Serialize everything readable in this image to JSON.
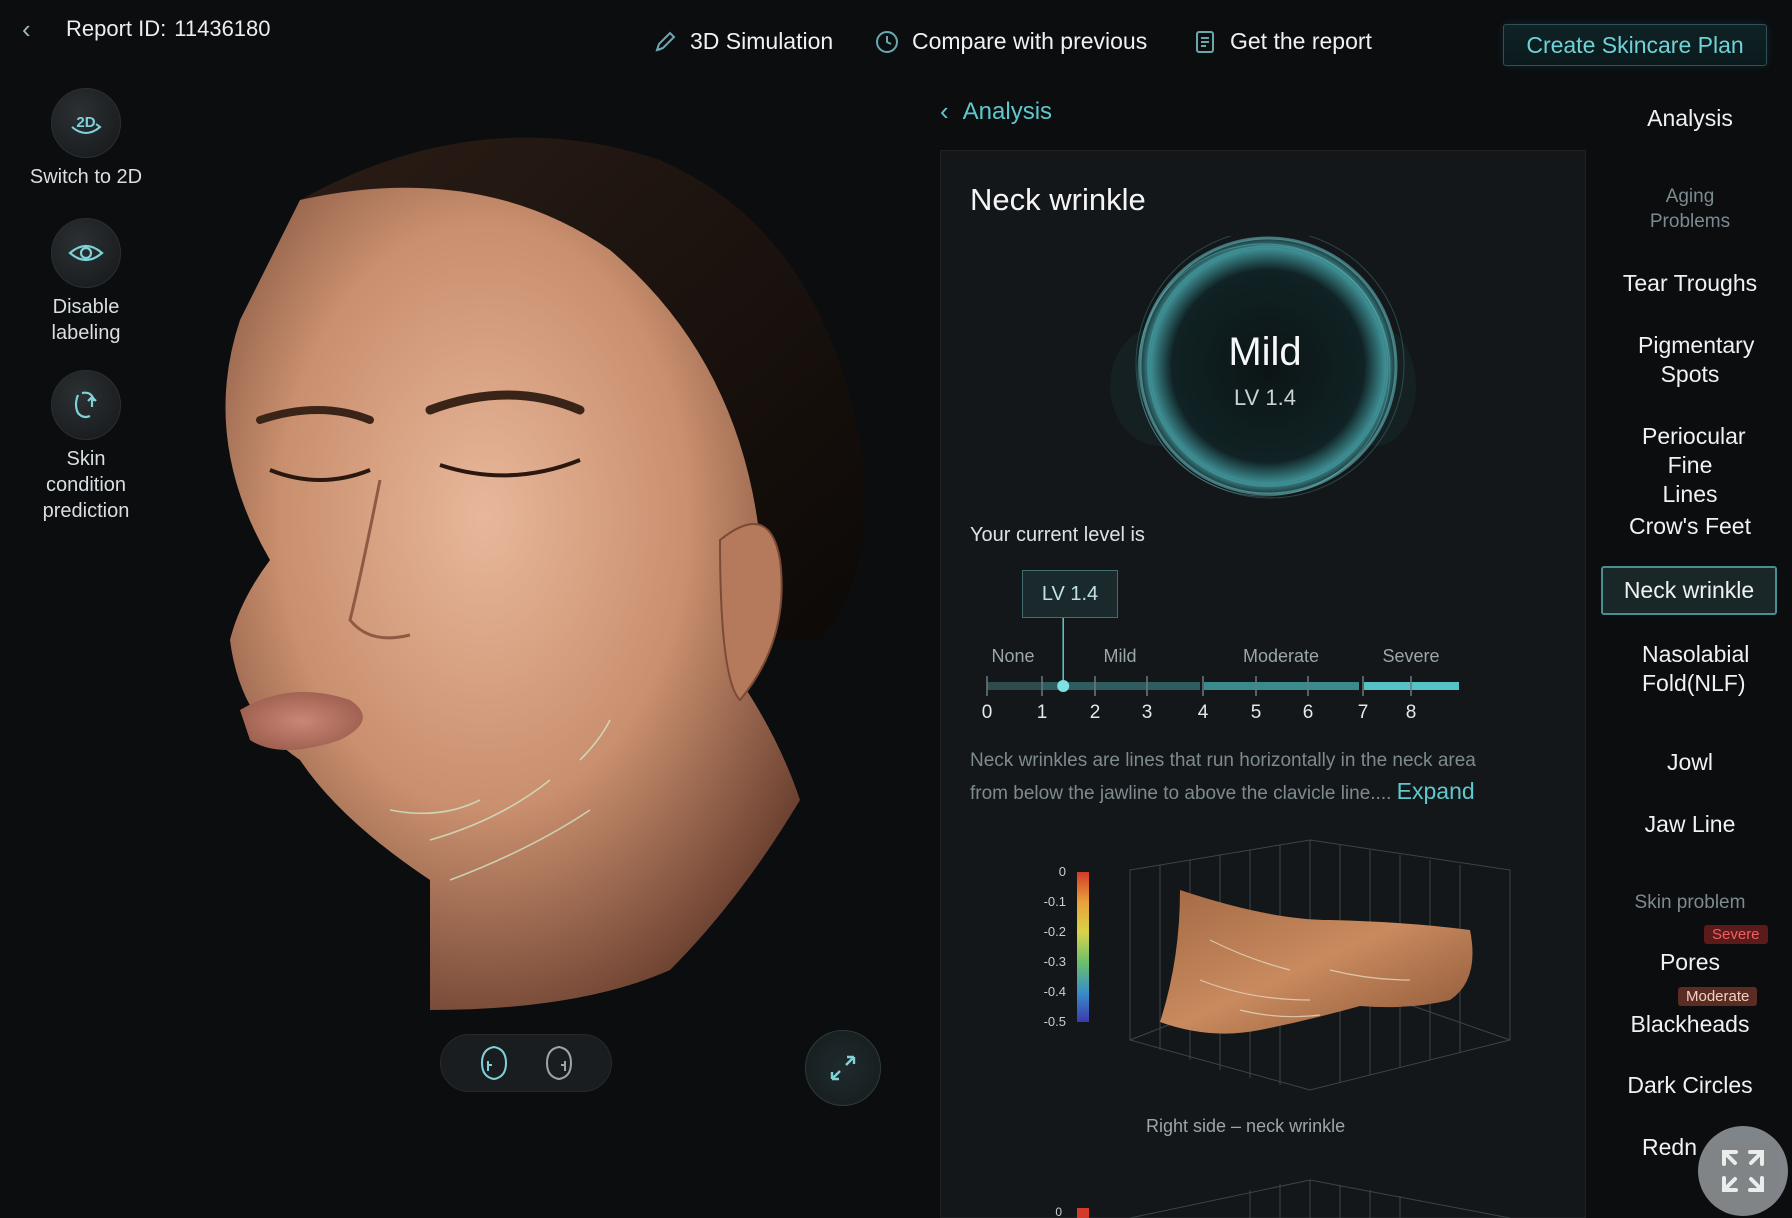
{
  "header": {
    "report_label": "Report ID:",
    "report_id": "11436180",
    "nav": [
      {
        "label": "3D Simulation",
        "icon": "pen-icon"
      },
      {
        "label": "Compare with previous",
        "icon": "clock-icon"
      },
      {
        "label": "Get the report",
        "icon": "document-icon"
      }
    ],
    "plan_button": "Create Skincare Plan"
  },
  "left_tools": [
    {
      "label_lines": [
        "Switch to 2D"
      ],
      "icon": "2d-rotate-icon"
    },
    {
      "label_lines": [
        "Disable",
        "labeling"
      ],
      "icon": "eye-icon"
    },
    {
      "label_lines": [
        "Skin",
        "condition",
        "prediction"
      ],
      "icon": "face-upward-icon"
    }
  ],
  "panel": {
    "back_label": "Analysis",
    "title": "Neck wrinkle",
    "severity": "Mild",
    "level": "LV 1.4",
    "current_level_label": "Your current level is",
    "level_box": "LV 1.4",
    "level_value": 1.4,
    "scale": {
      "categories": [
        "None",
        "Mild",
        "Moderate",
        "Severe"
      ],
      "ticks": [
        "0",
        "1",
        "2",
        "3",
        "4",
        "5",
        "6",
        "7",
        "8"
      ]
    },
    "description_lines": [
      "Neck wrinkles are lines that run horizontally in the neck area",
      "from below the jawline to above the clavicle line...."
    ],
    "expand_label": "Expand",
    "colorbar_ticks": [
      "0",
      "-0.1",
      "-0.2",
      "-0.3",
      "-0.4",
      "-0.5"
    ],
    "plot_caption": "Right side – neck wrinkle",
    "plot2_tick": "0"
  },
  "right_nav": {
    "title": "Analysis",
    "aging_section": "Aging Problems",
    "aging_items": [
      "Tear Troughs",
      "Pigmentary Spots",
      "Periocular Fine Lines",
      "Crow's Feet",
      "Neck wrinkle",
      "Nasolabial Fold(NLF)",
      "Jowl",
      "Jaw Line"
    ],
    "active_item": "Neck wrinkle",
    "skin_section": "Skin problem",
    "skin_items": [
      {
        "label": "Pores",
        "badge": "Severe"
      },
      {
        "label": "Blackheads",
        "badge": "Moderate"
      },
      {
        "label": "Dark Circles",
        "badge": ""
      },
      {
        "label": "Redn",
        "badge": ""
      }
    ]
  },
  "colors": {
    "accent": "#5fc8cd",
    "badge_severe": "#f06060",
    "panel_bg": "#141719"
  }
}
